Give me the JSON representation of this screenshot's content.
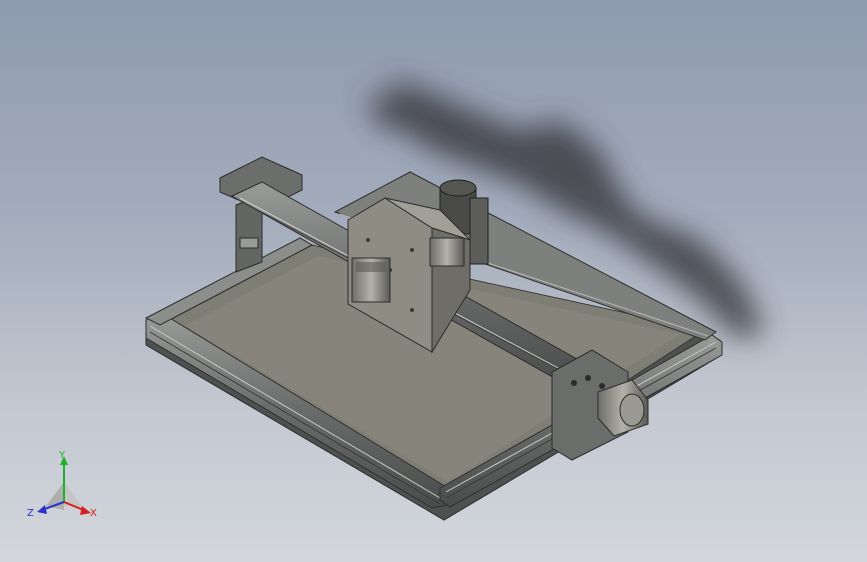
{
  "viewport": {
    "background_top": "#8e9aae",
    "background_bottom": "#d3d6dc",
    "model": {
      "description_icon": "cnc-router-3d-model-icon",
      "frame_color": "#5f6261",
      "bed_color": "#7c7b72",
      "plate_color": "#8f8c84",
      "motor_color": "#8a8a84"
    }
  },
  "triad": {
    "icon": "coordinate-triad-icon",
    "x_label": "X",
    "y_label": "Y",
    "z_label": "Z",
    "x_color": "#d62020",
    "y_color": "#1fb12a",
    "z_color": "#2a32c8"
  }
}
